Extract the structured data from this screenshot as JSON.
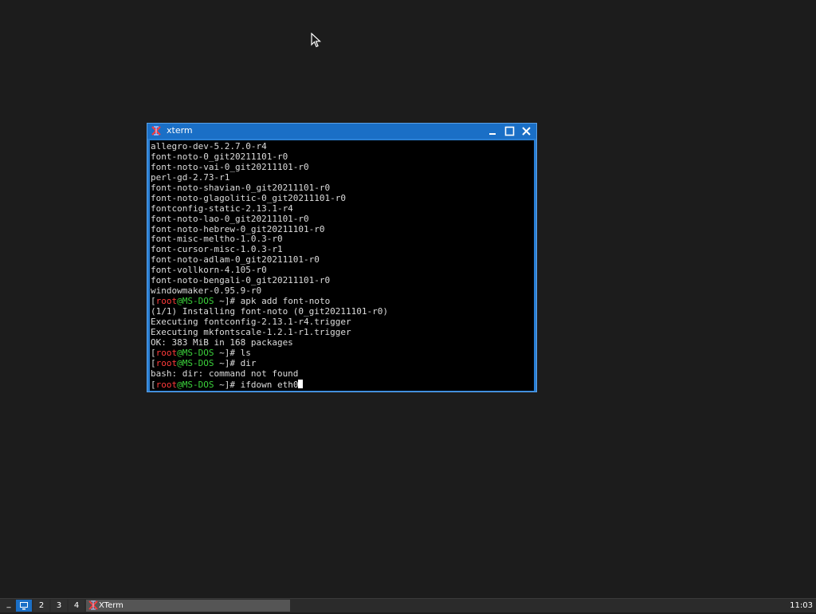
{
  "window": {
    "title": "xterm",
    "icon": "xterm-icon",
    "controls": [
      "minimize-icon",
      "maximize-icon",
      "close-icon"
    ]
  },
  "terminal": {
    "lines": [
      {
        "text": "allegro-dev-5.2.7.0-r4"
      },
      {
        "text": "font-noto-0_git20211101-r0"
      },
      {
        "text": "font-noto-vai-0_git20211101-r0"
      },
      {
        "text": "perl-gd-2.73-r1"
      },
      {
        "text": "font-noto-shavian-0_git20211101-r0"
      },
      {
        "text": "font-noto-glagolitic-0_git20211101-r0"
      },
      {
        "text": "fontconfig-static-2.13.1-r4"
      },
      {
        "text": "font-noto-lao-0_git20211101-r0"
      },
      {
        "text": "font-noto-hebrew-0_git20211101-r0"
      },
      {
        "text": "font-misc-meltho-1.0.3-r0"
      },
      {
        "text": "font-cursor-misc-1.0.3-r1"
      },
      {
        "text": "font-noto-adlam-0_git20211101-r0"
      },
      {
        "text": "font-vollkorn-4.105-r0"
      },
      {
        "text": "font-noto-bengali-0_git20211101-r0"
      },
      {
        "text": "windowmaker-0.95.9-r0"
      },
      {
        "prompt": true,
        "user": "root",
        "host": "MS-DOS",
        "path": "~",
        "command": "apk add font-noto"
      },
      {
        "text": "(1/1) Installing font-noto (0_git20211101-r0)"
      },
      {
        "text": "Executing fontconfig-2.13.1-r4.trigger"
      },
      {
        "text": "Executing mkfontscale-1.2.1-r1.trigger"
      },
      {
        "text": "OK: 383 MiB in 168 packages"
      },
      {
        "prompt": true,
        "user": "root",
        "host": "MS-DOS",
        "path": "~",
        "command": "ls"
      },
      {
        "prompt": true,
        "user": "root",
        "host": "MS-DOS",
        "path": "~",
        "command": "dir"
      },
      {
        "text": "bash: dir: command not found"
      },
      {
        "prompt": true,
        "user": "root",
        "host": "MS-DOS",
        "path": "~",
        "command": "ifdown eth0",
        "cursor": true
      }
    ]
  },
  "taskbar": {
    "menu_label": "_",
    "workspaces": [
      {
        "label": "",
        "icon": "desktop-icon",
        "active": true
      },
      {
        "label": "2"
      },
      {
        "label": "3"
      },
      {
        "label": "4"
      }
    ],
    "tasks": [
      {
        "label": "XTerm",
        "icon": "xterm-icon"
      }
    ],
    "clock": "11:03"
  },
  "colors": {
    "desktop": "#1c1c1c",
    "titlebar": "#1a6fc6",
    "prompt_user": "#ff3b3b",
    "prompt_host": "#3bd13b",
    "terminal_bg": "#000000",
    "terminal_fg": "#dcdcdc"
  }
}
